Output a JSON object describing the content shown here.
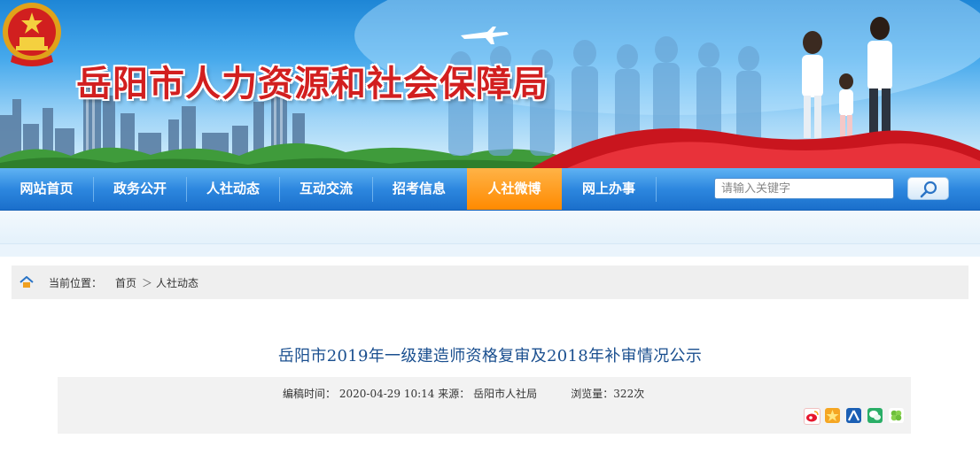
{
  "site": {
    "title": "岳阳市人力资源和社会保障局"
  },
  "colors": {
    "nav_blue": "#2d87df",
    "nav_active": "#ff8a00",
    "title_red": "#d21f1f",
    "article_title": "#1a4f8f"
  },
  "nav": {
    "items": [
      {
        "label": "网站首页",
        "active": false
      },
      {
        "label": "政务公开",
        "active": false
      },
      {
        "label": "人社动态",
        "active": false
      },
      {
        "label": "互动交流",
        "active": false
      },
      {
        "label": "招考信息",
        "active": false
      },
      {
        "label": "人社微博",
        "active": true
      },
      {
        "label": "网上办事",
        "active": false
      }
    ]
  },
  "search": {
    "placeholder": "请输入关键字",
    "button_icon": "search-icon"
  },
  "breadcrumb": {
    "label": "当前位置：",
    "home": "首页",
    "separator": "＞",
    "current": "人社动态",
    "icon": "home-icon"
  },
  "article": {
    "title": "岳阳市2019年一级建造师资格复审及2018年补审情况公示",
    "edit_time_label": "编稿时间：",
    "edit_time": "2020-04-29 10:14",
    "source_label": "来源：",
    "source": "岳阳市人社局",
    "views_label": "浏览量：",
    "views": "322次"
  },
  "share": [
    {
      "name": "weibo-icon",
      "color": "#e6162d"
    },
    {
      "name": "qzone-icon",
      "color": "#f5a623"
    },
    {
      "name": "renren-icon",
      "color": "#1b5fb4"
    },
    {
      "name": "wechat-icon",
      "color": "#2aae67"
    },
    {
      "name": "clover-icon",
      "color": "#6cbf3a"
    }
  ]
}
